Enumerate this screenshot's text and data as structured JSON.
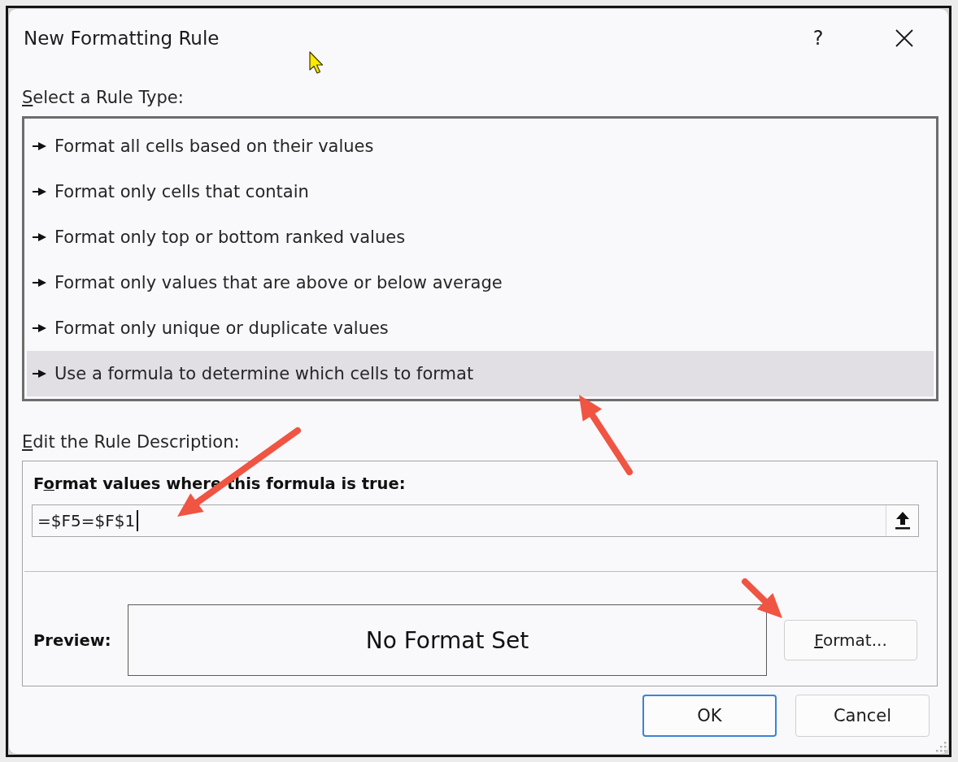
{
  "window": {
    "title": "New Formatting Rule",
    "help_button": "?"
  },
  "rule_type": {
    "label": "Select a Rule Type:",
    "items": [
      {
        "label": "Format all cells based on their values",
        "selected": false
      },
      {
        "label": "Format only cells that contain",
        "selected": false
      },
      {
        "label": "Format only top or bottom ranked values",
        "selected": false
      },
      {
        "label": "Format only values that are above or below average",
        "selected": false
      },
      {
        "label": "Format only unique or duplicate values",
        "selected": false
      },
      {
        "label": "Use a formula to determine which cells to format",
        "selected": true
      }
    ]
  },
  "rule_description": {
    "label": "Edit the Rule Description:",
    "formula_label": "Format values where this formula is true:",
    "formula_field": {
      "value": "=$F5=$F$1",
      "focused": true
    },
    "preview_label": "Preview:",
    "preview_text": "No Format Set",
    "format_button": {
      "label": "Format..."
    }
  },
  "buttons": [
    {
      "label": "OK",
      "default": true
    },
    {
      "label": "Cancel",
      "default": false
    }
  ]
}
